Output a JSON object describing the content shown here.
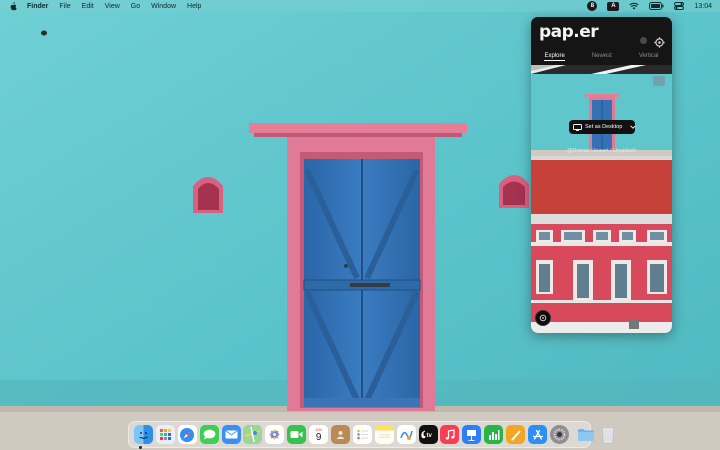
{
  "menubar": {
    "app_name": "Finder",
    "items": [
      "File",
      "Edit",
      "View",
      "Go",
      "Window",
      "Help"
    ],
    "status_badge": "8",
    "input_badge": "A",
    "clock": "13:04"
  },
  "paper_app": {
    "logo": "pap.er",
    "tabs": [
      "Explore",
      "Newest",
      "Vertical"
    ],
    "active_tab": "Explore",
    "set_desktop_label": "Set as Desktop",
    "photo_credit": "@Rowan Heuvel / Unsplash"
  },
  "dock": {
    "apps": [
      {
        "name": "finder",
        "icon": "finder-icon",
        "color": "#4aa7f0"
      },
      {
        "name": "launchpad",
        "icon": "launchpad-icon",
        "color": "#e9eaee"
      },
      {
        "name": "safari",
        "icon": "safari-icon",
        "color": "#2f8ef0"
      },
      {
        "name": "messages",
        "icon": "messages-icon",
        "color": "#3fcf55"
      },
      {
        "name": "mail",
        "icon": "mail-icon",
        "color": "#3b8ff0"
      },
      {
        "name": "maps",
        "icon": "maps-icon",
        "color": "#8fd18a"
      },
      {
        "name": "photos",
        "icon": "photos-icon",
        "color": "#ffffff"
      },
      {
        "name": "facetime",
        "icon": "facetime-icon",
        "color": "#36c24d"
      },
      {
        "name": "calendar",
        "icon": "calendar-icon",
        "color": "#ffffff",
        "month": "JUN",
        "day": "9"
      },
      {
        "name": "contacts",
        "icon": "contacts-icon",
        "color": "#b88a55"
      },
      {
        "name": "reminders",
        "icon": "reminders-icon",
        "color": "#ffffff"
      },
      {
        "name": "notes",
        "icon": "notes-icon",
        "color": "#ffe062"
      },
      {
        "name": "freeform",
        "icon": "freeform-icon",
        "color": "#ffffff"
      },
      {
        "name": "tv",
        "icon": "tv-icon",
        "color": "#111111"
      },
      {
        "name": "music",
        "icon": "music-icon",
        "color": "#fa3c55"
      },
      {
        "name": "keynote",
        "icon": "keynote-icon",
        "color": "#2e7ef5"
      },
      {
        "name": "numbers",
        "icon": "numbers-icon",
        "color": "#27b548"
      },
      {
        "name": "pages",
        "icon": "pages-icon",
        "color": "#f5a524"
      },
      {
        "name": "app-store",
        "icon": "app-store-icon",
        "color": "#2b8ff7"
      },
      {
        "name": "system-settings",
        "icon": "system-settings-icon",
        "color": "#8e8e93"
      }
    ],
    "folders": [
      {
        "name": "downloads",
        "icon": "folder-icon",
        "color": "#6cb5e8"
      },
      {
        "name": "trash",
        "icon": "trash-icon",
        "color": "#d6dadd"
      }
    ]
  },
  "accent_colors": {
    "wall": "#5cc6cc",
    "door": "#2f6fb3",
    "door_frame": "#e07a96"
  }
}
